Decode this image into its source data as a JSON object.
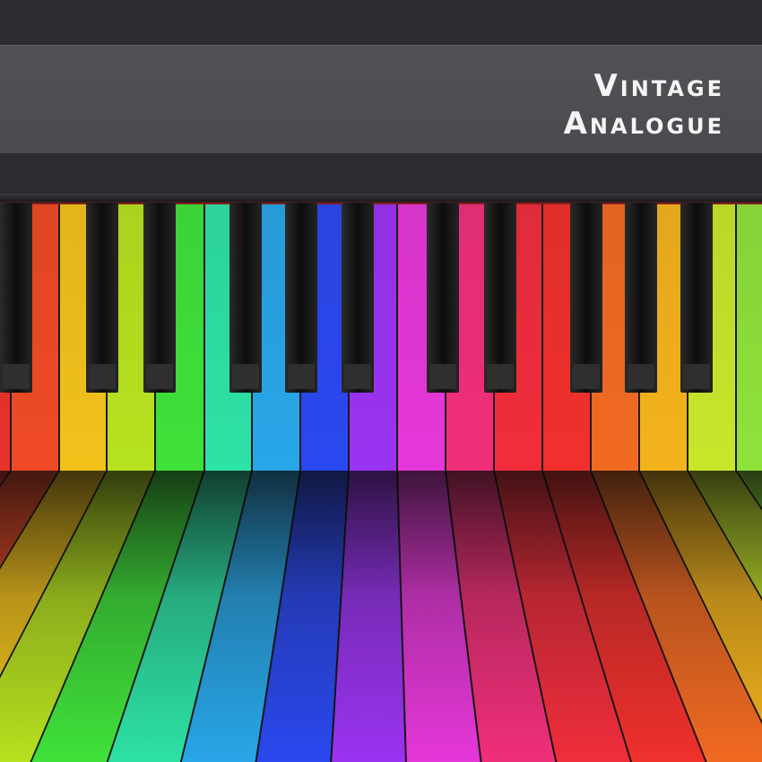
{
  "title": {
    "line1": "Vintage",
    "line2": "Analogue"
  },
  "palette": {
    "panel": "#4f5054",
    "frame": "#2c2d30",
    "white_key_colors": [
      "#e8332b",
      "#ef4a25",
      "#f2c21b",
      "#b7e21f",
      "#3fe23a",
      "#2de2a6",
      "#28a6e8",
      "#2a48f0",
      "#9b33f2",
      "#e637d9",
      "#f12f79",
      "#f12d3c",
      "#f1302c",
      "#f26a22",
      "#f4b31c",
      "#c9e62a",
      "#8fe23a",
      "#34e06a"
    ]
  }
}
